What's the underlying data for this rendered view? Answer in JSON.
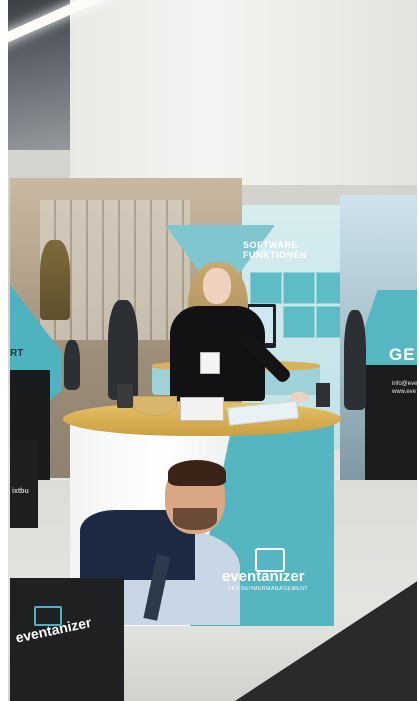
{
  "scene": {
    "description_colors": {
      "teal": "#55b5c1",
      "counter_wood": "#d8b25a",
      "dark_panel": "#1c1c1e"
    }
  },
  "booth": {
    "wall_title_line1": "SOFTWARE",
    "wall_title_line2": "FUNKTIONEN",
    "right_panel_text": "GE",
    "right_panel_info_1": "info@eve",
    "right_panel_info_2": "www.eve",
    "left_panel_text": "RT"
  },
  "counter": {
    "logo_text": "eventanizer",
    "logo_tagline": "TEILNEHMERMANAGEMENT"
  },
  "boxes": {
    "front_box_text": "eventanizer",
    "left_box_text": "ixtbu"
  }
}
